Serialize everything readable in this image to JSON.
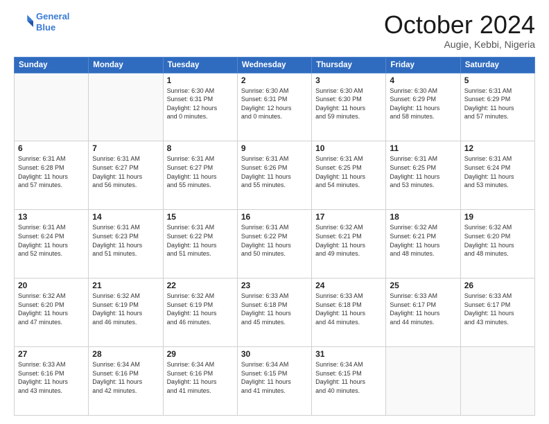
{
  "header": {
    "logo_line1": "General",
    "logo_line2": "Blue",
    "title": "October 2024",
    "subtitle": "Augie, Kebbi, Nigeria"
  },
  "calendar": {
    "weekdays": [
      "Sunday",
      "Monday",
      "Tuesday",
      "Wednesday",
      "Thursday",
      "Friday",
      "Saturday"
    ],
    "weeks": [
      [
        {
          "day": "",
          "detail": ""
        },
        {
          "day": "",
          "detail": ""
        },
        {
          "day": "1",
          "detail": "Sunrise: 6:30 AM\nSunset: 6:31 PM\nDaylight: 12 hours\nand 0 minutes."
        },
        {
          "day": "2",
          "detail": "Sunrise: 6:30 AM\nSunset: 6:31 PM\nDaylight: 12 hours\nand 0 minutes."
        },
        {
          "day": "3",
          "detail": "Sunrise: 6:30 AM\nSunset: 6:30 PM\nDaylight: 11 hours\nand 59 minutes."
        },
        {
          "day": "4",
          "detail": "Sunrise: 6:30 AM\nSunset: 6:29 PM\nDaylight: 11 hours\nand 58 minutes."
        },
        {
          "day": "5",
          "detail": "Sunrise: 6:31 AM\nSunset: 6:29 PM\nDaylight: 11 hours\nand 57 minutes."
        }
      ],
      [
        {
          "day": "6",
          "detail": "Sunrise: 6:31 AM\nSunset: 6:28 PM\nDaylight: 11 hours\nand 57 minutes."
        },
        {
          "day": "7",
          "detail": "Sunrise: 6:31 AM\nSunset: 6:27 PM\nDaylight: 11 hours\nand 56 minutes."
        },
        {
          "day": "8",
          "detail": "Sunrise: 6:31 AM\nSunset: 6:27 PM\nDaylight: 11 hours\nand 55 minutes."
        },
        {
          "day": "9",
          "detail": "Sunrise: 6:31 AM\nSunset: 6:26 PM\nDaylight: 11 hours\nand 55 minutes."
        },
        {
          "day": "10",
          "detail": "Sunrise: 6:31 AM\nSunset: 6:25 PM\nDaylight: 11 hours\nand 54 minutes."
        },
        {
          "day": "11",
          "detail": "Sunrise: 6:31 AM\nSunset: 6:25 PM\nDaylight: 11 hours\nand 53 minutes."
        },
        {
          "day": "12",
          "detail": "Sunrise: 6:31 AM\nSunset: 6:24 PM\nDaylight: 11 hours\nand 53 minutes."
        }
      ],
      [
        {
          "day": "13",
          "detail": "Sunrise: 6:31 AM\nSunset: 6:24 PM\nDaylight: 11 hours\nand 52 minutes."
        },
        {
          "day": "14",
          "detail": "Sunrise: 6:31 AM\nSunset: 6:23 PM\nDaylight: 11 hours\nand 51 minutes."
        },
        {
          "day": "15",
          "detail": "Sunrise: 6:31 AM\nSunset: 6:22 PM\nDaylight: 11 hours\nand 51 minutes."
        },
        {
          "day": "16",
          "detail": "Sunrise: 6:31 AM\nSunset: 6:22 PM\nDaylight: 11 hours\nand 50 minutes."
        },
        {
          "day": "17",
          "detail": "Sunrise: 6:32 AM\nSunset: 6:21 PM\nDaylight: 11 hours\nand 49 minutes."
        },
        {
          "day": "18",
          "detail": "Sunrise: 6:32 AM\nSunset: 6:21 PM\nDaylight: 11 hours\nand 48 minutes."
        },
        {
          "day": "19",
          "detail": "Sunrise: 6:32 AM\nSunset: 6:20 PM\nDaylight: 11 hours\nand 48 minutes."
        }
      ],
      [
        {
          "day": "20",
          "detail": "Sunrise: 6:32 AM\nSunset: 6:20 PM\nDaylight: 11 hours\nand 47 minutes."
        },
        {
          "day": "21",
          "detail": "Sunrise: 6:32 AM\nSunset: 6:19 PM\nDaylight: 11 hours\nand 46 minutes."
        },
        {
          "day": "22",
          "detail": "Sunrise: 6:32 AM\nSunset: 6:19 PM\nDaylight: 11 hours\nand 46 minutes."
        },
        {
          "day": "23",
          "detail": "Sunrise: 6:33 AM\nSunset: 6:18 PM\nDaylight: 11 hours\nand 45 minutes."
        },
        {
          "day": "24",
          "detail": "Sunrise: 6:33 AM\nSunset: 6:18 PM\nDaylight: 11 hours\nand 44 minutes."
        },
        {
          "day": "25",
          "detail": "Sunrise: 6:33 AM\nSunset: 6:17 PM\nDaylight: 11 hours\nand 44 minutes."
        },
        {
          "day": "26",
          "detail": "Sunrise: 6:33 AM\nSunset: 6:17 PM\nDaylight: 11 hours\nand 43 minutes."
        }
      ],
      [
        {
          "day": "27",
          "detail": "Sunrise: 6:33 AM\nSunset: 6:16 PM\nDaylight: 11 hours\nand 43 minutes."
        },
        {
          "day": "28",
          "detail": "Sunrise: 6:34 AM\nSunset: 6:16 PM\nDaylight: 11 hours\nand 42 minutes."
        },
        {
          "day": "29",
          "detail": "Sunrise: 6:34 AM\nSunset: 6:16 PM\nDaylight: 11 hours\nand 41 minutes."
        },
        {
          "day": "30",
          "detail": "Sunrise: 6:34 AM\nSunset: 6:15 PM\nDaylight: 11 hours\nand 41 minutes."
        },
        {
          "day": "31",
          "detail": "Sunrise: 6:34 AM\nSunset: 6:15 PM\nDaylight: 11 hours\nand 40 minutes."
        },
        {
          "day": "",
          "detail": ""
        },
        {
          "day": "",
          "detail": ""
        }
      ]
    ]
  }
}
